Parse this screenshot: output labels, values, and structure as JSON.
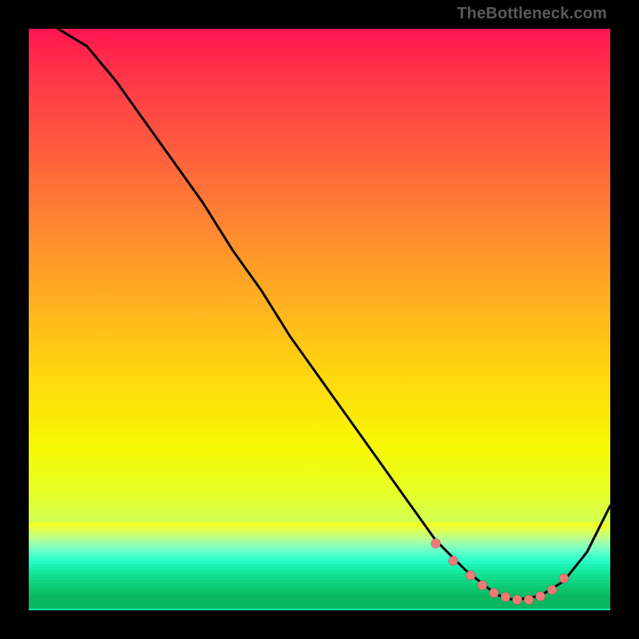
{
  "watermark": "TheBottleneck.com",
  "chart_data": {
    "type": "line",
    "title": "",
    "xlabel": "",
    "ylabel": "",
    "xlim": [
      0,
      100
    ],
    "ylim": [
      0,
      100
    ],
    "grid": false,
    "legend": false,
    "series": [
      {
        "name": "curve",
        "color": "#000000",
        "x": [
          5,
          10,
          15,
          20,
          25,
          30,
          35,
          40,
          45,
          50,
          55,
          60,
          65,
          70,
          75,
          80,
          82,
          84,
          88,
          92,
          96,
          100
        ],
        "y": [
          100,
          97,
          91,
          84,
          77,
          70,
          62,
          55,
          47,
          40,
          33,
          26,
          19,
          12,
          7,
          3,
          2,
          1.8,
          2.5,
          5,
          10,
          18
        ]
      }
    ],
    "markers": {
      "name": "highlight-points",
      "color": "#ee7a77",
      "radius_px": 6,
      "x": [
        70,
        73,
        76,
        78,
        80,
        82,
        84,
        86,
        88,
        90,
        92
      ],
      "y": [
        11.5,
        8.5,
        6,
        4.3,
        3,
        2.3,
        1.8,
        1.8,
        2.4,
        3.5,
        5.5
      ]
    },
    "background_gradient_stops": [
      {
        "pos": 0.0,
        "color": "#ff1450"
      },
      {
        "pos": 0.06,
        "color": "#ff2e4a"
      },
      {
        "pos": 0.2,
        "color": "#ff5a3e"
      },
      {
        "pos": 0.35,
        "color": "#ff8a30"
      },
      {
        "pos": 0.48,
        "color": "#ffb41f"
      },
      {
        "pos": 0.6,
        "color": "#ffd80e"
      },
      {
        "pos": 0.72,
        "color": "#f7f904"
      },
      {
        "pos": 0.8,
        "color": "#e6ff28"
      },
      {
        "pos": 0.87,
        "color": "#c8ff66"
      },
      {
        "pos": 0.92,
        "color": "#9cffab"
      },
      {
        "pos": 0.95,
        "color": "#5cffcc"
      },
      {
        "pos": 0.97,
        "color": "#2fffc8"
      },
      {
        "pos": 1.0,
        "color": "#14f1aa"
      }
    ]
  }
}
